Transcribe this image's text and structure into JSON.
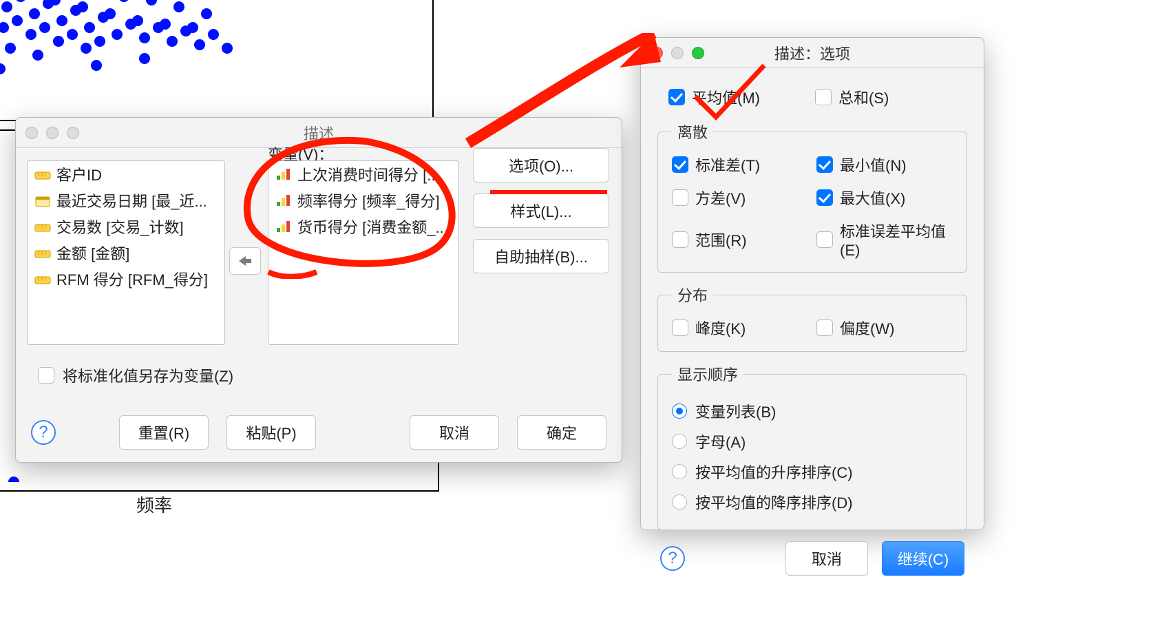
{
  "background": {
    "axis_label": "频率"
  },
  "main_dialog": {
    "title": "描述",
    "variables_label": "变量(V)：",
    "left_list": [
      "客户ID",
      "最近交易日期 [最_近...",
      "交易数 [交易_计数]",
      "金额 [金额]",
      "RFM 得分 [RFM_得分]"
    ],
    "right_list": [
      "上次消费时间得分 [...",
      "频率得分 [频率_得分]",
      "货币得分 [消费金额_..."
    ],
    "side_buttons": {
      "options": "选项(O)...",
      "styles": "样式(L)...",
      "bootstrap": "自助抽样(B)..."
    },
    "save_z": "将标准化值另存为变量(Z)",
    "bottom": {
      "help": "?",
      "reset": "重置(R)",
      "paste": "粘贴(P)",
      "cancel": "取消",
      "ok": "确定"
    }
  },
  "options_dialog": {
    "title": "描述：选项",
    "mean": "平均值(M)",
    "sum": "总和(S)",
    "dispersion_legend": "离散",
    "std": "标准差(T)",
    "min": "最小值(N)",
    "var": "方差(V)",
    "max": "最大值(X)",
    "range": "范围(R)",
    "se_mean": "标准误差平均值(E)",
    "distribution_legend": "分布",
    "kurt": "峰度(K)",
    "skew": "偏度(W)",
    "order_legend": "显示顺序",
    "order_var": "变量列表(B)",
    "order_alpha": "字母(A)",
    "order_asc": "按平均值的升序排序(C)",
    "order_desc": "按平均值的降序排序(D)",
    "footer": {
      "help": "?",
      "cancel": "取消",
      "continue": "继续(C)"
    }
  }
}
